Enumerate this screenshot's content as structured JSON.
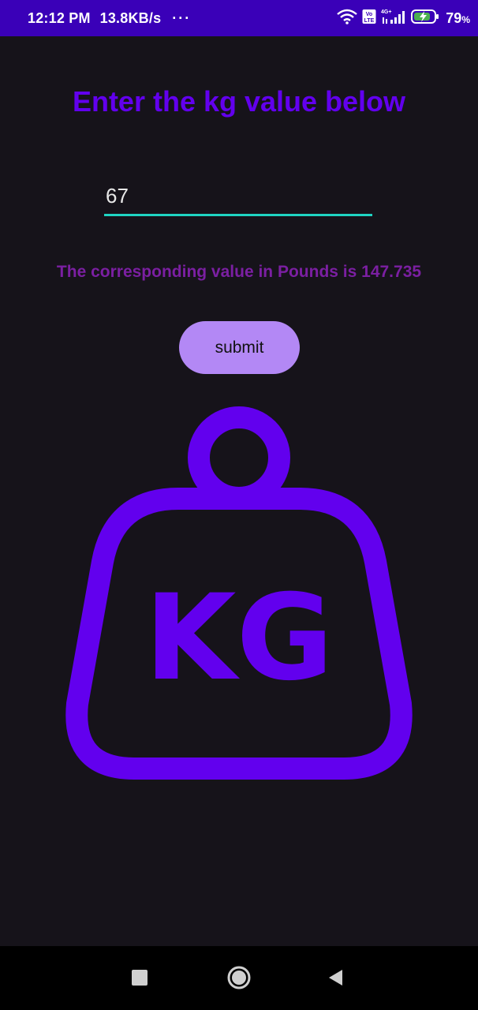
{
  "status_bar": {
    "time": "12:12 PM",
    "network_speed": "13.8KB/s",
    "overflow": "···",
    "network_type": "4G+",
    "volte": "Vo LTE",
    "battery_value": "79",
    "battery_unit": "%",
    "background_color": "#3a00b8"
  },
  "main": {
    "title": "Enter the kg value below",
    "input_value": "67",
    "result_text": "The corresponding value in Pounds is 147.735",
    "submit_label": "submit",
    "image_text": "KG",
    "title_color": "#6200ee",
    "result_color": "#7b1fa2",
    "input_underline_color": "#1fd4c2",
    "button_color": "#b388f5",
    "background_color": "#16131a"
  },
  "nav_bar": {
    "icons": [
      "recents-icon",
      "home-icon",
      "back-icon"
    ]
  }
}
